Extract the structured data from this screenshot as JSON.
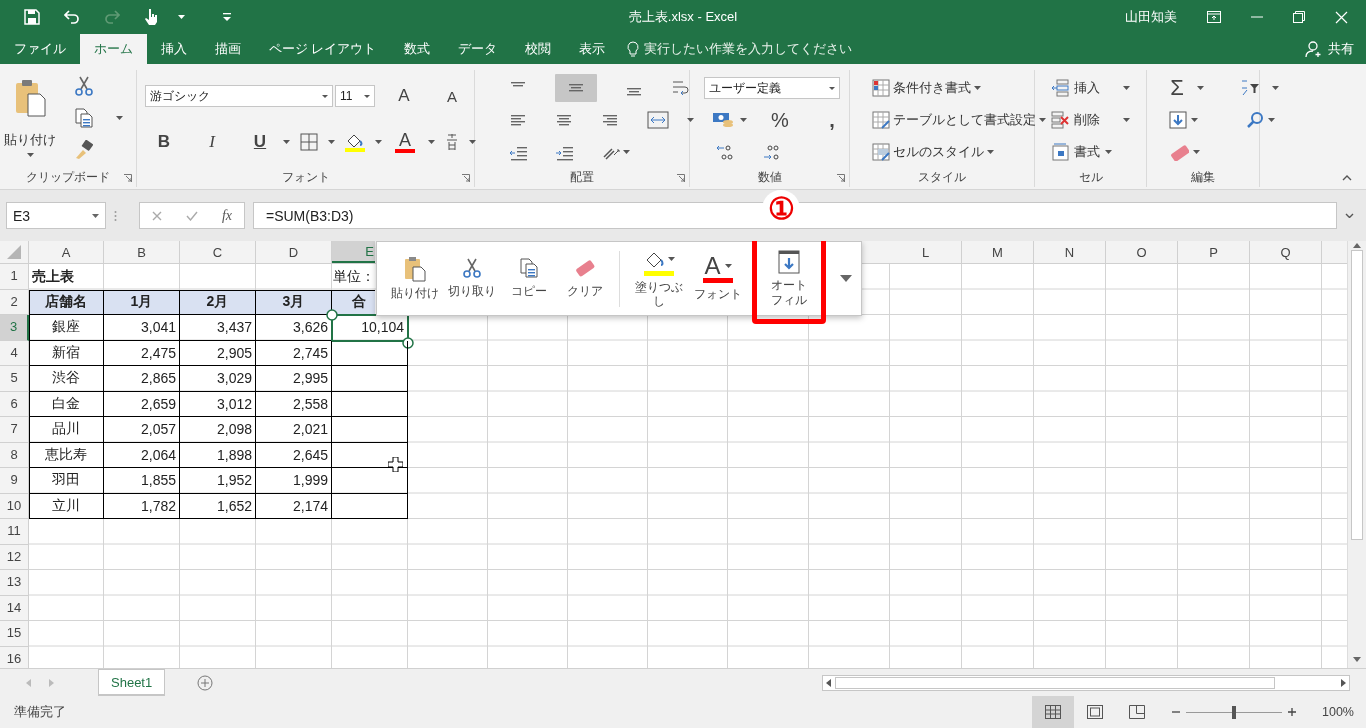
{
  "window": {
    "title": "売上表.xlsx - Excel",
    "user": "山田知美"
  },
  "ribbon_tabs": [
    {
      "label": "ファイル",
      "selected": false
    },
    {
      "label": "ホーム",
      "selected": true
    },
    {
      "label": "挿入",
      "selected": false
    },
    {
      "label": "描画",
      "selected": false
    },
    {
      "label": "ページ レイアウト",
      "selected": false
    },
    {
      "label": "数式",
      "selected": false
    },
    {
      "label": "データ",
      "selected": false
    },
    {
      "label": "校閲",
      "selected": false
    },
    {
      "label": "表示",
      "selected": false
    }
  ],
  "tell_me": {
    "placeholder": "実行したい作業を入力してください"
  },
  "share": "共有",
  "ribbon": {
    "clipboard": {
      "label": "クリップボード",
      "paste": "貼り付け"
    },
    "font": {
      "label": "フォント",
      "font_name": "游ゴシック",
      "font_size": "11",
      "grow": "A",
      "shrink": "A",
      "bold": "B",
      "italic": "I",
      "underline": "U",
      "font_color": "A"
    },
    "alignment": {
      "label": "配置",
      "buttons": [
        {
          "kind": "top",
          "selected": false
        },
        {
          "kind": "middle",
          "selected": true
        },
        {
          "kind": "bottom",
          "selected": false
        }
      ]
    },
    "number": {
      "label": "数値",
      "format": "ユーザー定義",
      "percent": "%",
      "comma": ","
    },
    "styles": {
      "label": "スタイル",
      "items": [
        {
          "kind": "conditional",
          "label": "条件付き書式"
        },
        {
          "kind": "table",
          "label": "テーブルとして書式設定"
        },
        {
          "kind": "cell",
          "label": "セルのスタイル"
        }
      ]
    },
    "cells": {
      "label": "セル",
      "items": [
        {
          "kind": "insert",
          "label": "挿入"
        },
        {
          "kind": "delete",
          "label": "削除"
        },
        {
          "kind": "format",
          "label": "書式"
        }
      ]
    },
    "editing": {
      "label": "編集",
      "sum": "Σ"
    }
  },
  "formula_bar": {
    "name_box": "E3",
    "fx": "fx",
    "formula": "=SUM(B3:D3)"
  },
  "callout": "①",
  "sheet": {
    "columns": [
      {
        "label": "A",
        "selected": false
      },
      {
        "label": "B",
        "selected": false
      },
      {
        "label": "C",
        "selected": false
      },
      {
        "label": "D",
        "selected": false
      },
      {
        "label": "E",
        "selected": true
      }
    ],
    "columns_right": [
      {
        "label": "L",
        "selected": false
      },
      {
        "label": "M",
        "selected": false
      },
      {
        "label": "N",
        "selected": false
      },
      {
        "label": "O",
        "selected": false
      },
      {
        "label": "P",
        "selected": false
      },
      {
        "label": "Q",
        "selected": false
      }
    ],
    "rows": [
      {
        "number": "1",
        "kind": "title",
        "selected": false,
        "a": "売上表",
        "e": "単位："
      },
      {
        "number": "2",
        "kind": "header",
        "selected": false,
        "a": "店舗名",
        "b": "1月",
        "c": "2月",
        "d": "3月",
        "e": "合"
      },
      {
        "number": "3",
        "kind": "data",
        "selected": true,
        "a": "銀座",
        "b": "3,041",
        "c": "3,437",
        "d": "3,626",
        "e": "10,104"
      },
      {
        "number": "4",
        "kind": "data",
        "selected": false,
        "a": "新宿",
        "b": "2,475",
        "c": "2,905",
        "d": "2,745"
      },
      {
        "number": "5",
        "kind": "data",
        "selected": false,
        "a": "渋谷",
        "b": "2,865",
        "c": "3,029",
        "d": "2,995"
      },
      {
        "number": "6",
        "kind": "data",
        "selected": false,
        "a": "白金",
        "b": "2,659",
        "c": "3,012",
        "d": "2,558"
      },
      {
        "number": "7",
        "kind": "data",
        "selected": false,
        "a": "品川",
        "b": "2,057",
        "c": "2,098",
        "d": "2,021"
      },
      {
        "number": "8",
        "kind": "data",
        "selected": false,
        "a": "恵比寿",
        "b": "2,064",
        "c": "1,898",
        "d": "2,645"
      },
      {
        "number": "9",
        "kind": "data",
        "selected": false,
        "a": "羽田",
        "b": "1,855",
        "c": "1,952",
        "d": "1,999"
      },
      {
        "number": "10",
        "kind": "data",
        "selected": false,
        "a": "立川",
        "b": "1,782",
        "c": "1,652",
        "d": "2,174"
      },
      {
        "number": "11",
        "kind": "empty",
        "selected": false
      },
      {
        "number": "12",
        "kind": "empty",
        "selected": false
      },
      {
        "number": "13",
        "kind": "empty",
        "selected": false
      },
      {
        "number": "14",
        "kind": "empty",
        "selected": false
      },
      {
        "number": "15",
        "kind": "empty",
        "selected": false
      },
      {
        "number": "16",
        "kind": "empty",
        "selected": false
      }
    ]
  },
  "mini_toolbar": {
    "items": [
      {
        "kind": "paste",
        "label": "貼り付け",
        "highlighted": false
      },
      {
        "kind": "cut",
        "label": "切り取り",
        "highlighted": false
      },
      {
        "kind": "copy",
        "label": "コピー",
        "highlighted": false
      },
      {
        "kind": "clear",
        "label": "クリア",
        "highlighted": false
      },
      {
        "kind": "fill",
        "label": "塗りつぶし",
        "highlighted": false
      },
      {
        "kind": "font",
        "label": "フォント",
        "glyph": "A",
        "highlighted": false
      },
      {
        "kind": "autofill",
        "label": "オートフィル",
        "highlighted": true
      }
    ]
  },
  "sheet_tabs": [
    {
      "label": "Sheet1",
      "selected": true
    }
  ],
  "status_bar": {
    "text": "準備完了",
    "views": [
      {
        "kind": "normal",
        "selected": true
      },
      {
        "kind": "page_layout",
        "selected": false
      },
      {
        "kind": "page_break",
        "selected": false
      }
    ],
    "zoom": {
      "level": 0.5,
      "reading": "100%"
    }
  }
}
